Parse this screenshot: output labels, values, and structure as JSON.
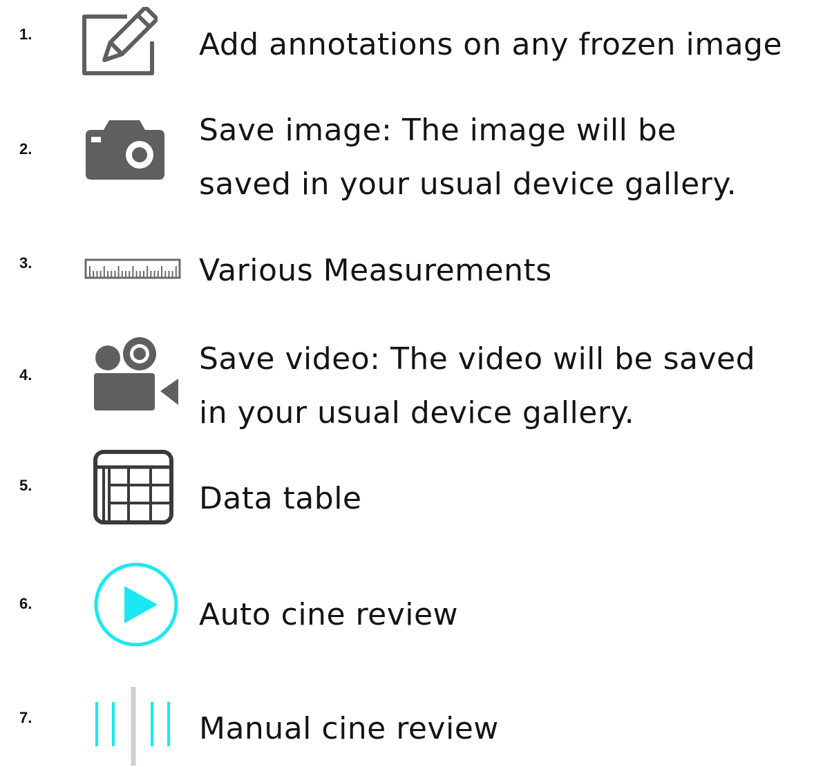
{
  "colors": {
    "icon_gray": "#5f5f5f",
    "icon_dark": "#3a3a3a",
    "accent_cyan": "#19e8f2",
    "divider_gray": "#cfcfcf",
    "text": "#141414"
  },
  "items": [
    {
      "number": "1.",
      "icon": "pencil-edit-icon",
      "lines": [
        "Add annotations on any frozen image"
      ]
    },
    {
      "number": "2.",
      "icon": "camera-icon",
      "lines": [
        "Save image: The image will be",
        "saved in your usual device gallery."
      ]
    },
    {
      "number": "3.",
      "icon": "ruler-icon",
      "lines": [
        "Various Measurements"
      ]
    },
    {
      "number": "4.",
      "icon": "video-camera-icon",
      "lines": [
        "Save video: The video will be saved",
        "in your usual device gallery."
      ]
    },
    {
      "number": "5.",
      "icon": "table-icon",
      "lines": [
        "Data table"
      ]
    },
    {
      "number": "6.",
      "icon": "play-circle-icon",
      "lines": [
        "Auto cine review"
      ]
    },
    {
      "number": "7.",
      "icon": "manual-cine-bars-icon",
      "lines": [
        "Manual cine review"
      ]
    }
  ]
}
